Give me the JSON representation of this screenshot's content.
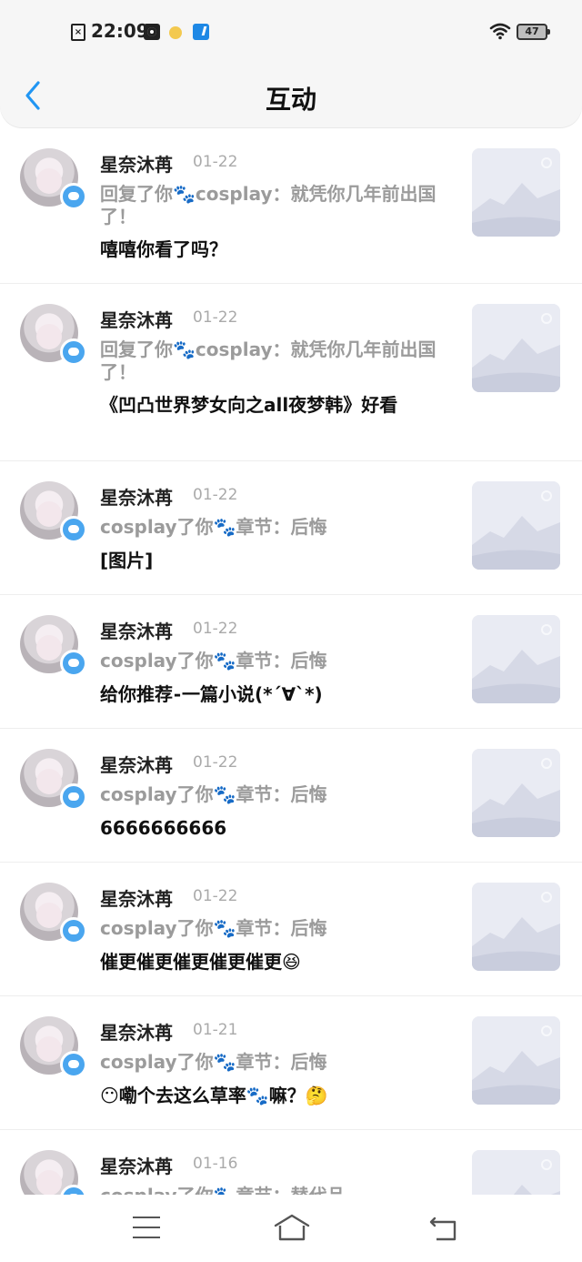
{
  "status_bar": {
    "time": "22:09",
    "file_icon_glyph": "×",
    "battery": "47",
    "icons": [
      "file-x-icon",
      "app-icon-dark",
      "emoji-icon",
      "app-icon-blue",
      "wifi-icon",
      "battery-icon"
    ]
  },
  "header": {
    "title": "互动",
    "back_icon": "chevron-left-icon",
    "accent": "#2196f3"
  },
  "items": [
    {
      "name": "星奈沐苒",
      "date": "01-22",
      "subtitle": "回复了你🐾cosplay：就凭你几年前出国了！",
      "text": "嘻嘻你看了吗？"
    },
    {
      "name": "星奈沐苒",
      "date": "01-22",
      "subtitle": "回复了你🐾cosplay：就凭你几年前出国了！",
      "text": "《凹凸世界梦女向之all夜梦韩》好看"
    },
    {
      "name": "星奈沐苒",
      "date": "01-22",
      "subtitle": "cosplay了你🐾章节：后悔",
      "text": "[图片]"
    },
    {
      "name": "星奈沐苒",
      "date": "01-22",
      "subtitle": "cosplay了你🐾章节：后悔",
      "text": "给你推荐⁃一篇小说(*´∀`*)"
    },
    {
      "name": "星奈沐苒",
      "date": "01-22",
      "subtitle": "cosplay了你🐾章节：后悔",
      "text": "6666666666"
    },
    {
      "name": "星奈沐苒",
      "date": "01-22",
      "subtitle": "cosplay了你🐾章节：后悔",
      "text": "催更催更催更催更催更😆"
    },
    {
      "name": "星奈沐苒",
      "date": "01-21",
      "subtitle": "cosplay了你🐾章节：后悔",
      "text": "😶嘞个去这么草率🐾嘛？🤔"
    },
    {
      "name": "星奈沐苒",
      "date": "01-16",
      "subtitle": "cosplay了你🐾章节：替代品",
      "text": ""
    }
  ],
  "nav_bar": {
    "icons": [
      "menu-icon",
      "home-icon",
      "back-icon"
    ]
  }
}
